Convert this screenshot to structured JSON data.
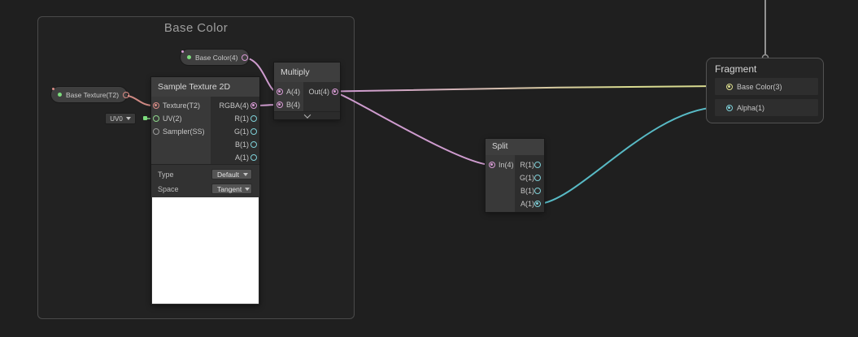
{
  "group": {
    "title": "Base Color"
  },
  "pills": {
    "base_color": {
      "label": "Base Color(4)"
    },
    "base_texture": {
      "label": "Base Texture(T2)"
    }
  },
  "uv_default": {
    "value": "UV0"
  },
  "sample_node": {
    "title": "Sample Texture 2D",
    "inputs": {
      "texture": "Texture(T2)",
      "uv": "UV(2)",
      "sampler": "Sampler(SS)"
    },
    "outputs": {
      "rgba": "RGBA(4)",
      "r": "R(1)",
      "g": "G(1)",
      "b": "B(1)",
      "a": "A(1)"
    },
    "controls": {
      "type_label": "Type",
      "type_value": "Default",
      "space_label": "Space",
      "space_value": "Tangent"
    }
  },
  "multiply_node": {
    "title": "Multiply",
    "inputs": {
      "a": "A(4)",
      "b": "B(4)"
    },
    "outputs": {
      "out": "Out(4)"
    }
  },
  "split_node": {
    "title": "Split",
    "inputs": {
      "in": "In(4)"
    },
    "outputs": {
      "r": "R(1)",
      "g": "G(1)",
      "b": "B(1)",
      "a": "A(1)"
    }
  },
  "fragment_node": {
    "title": "Fragment",
    "inputs": {
      "base_color": "Base Color(3)",
      "alpha": "Alpha(1)"
    }
  },
  "colors": {
    "background": "#1f1f1f",
    "vector4_pink": "#d79ad4",
    "vector3_yellow": "#dcdd8e",
    "vector2_green": "#8ed88b",
    "float_cyan": "#7ed0d8",
    "texture2d_red": "#d98c86",
    "sampler_gray": "#9a9a9a",
    "exposed_dot_green": "#7ddc7d"
  }
}
